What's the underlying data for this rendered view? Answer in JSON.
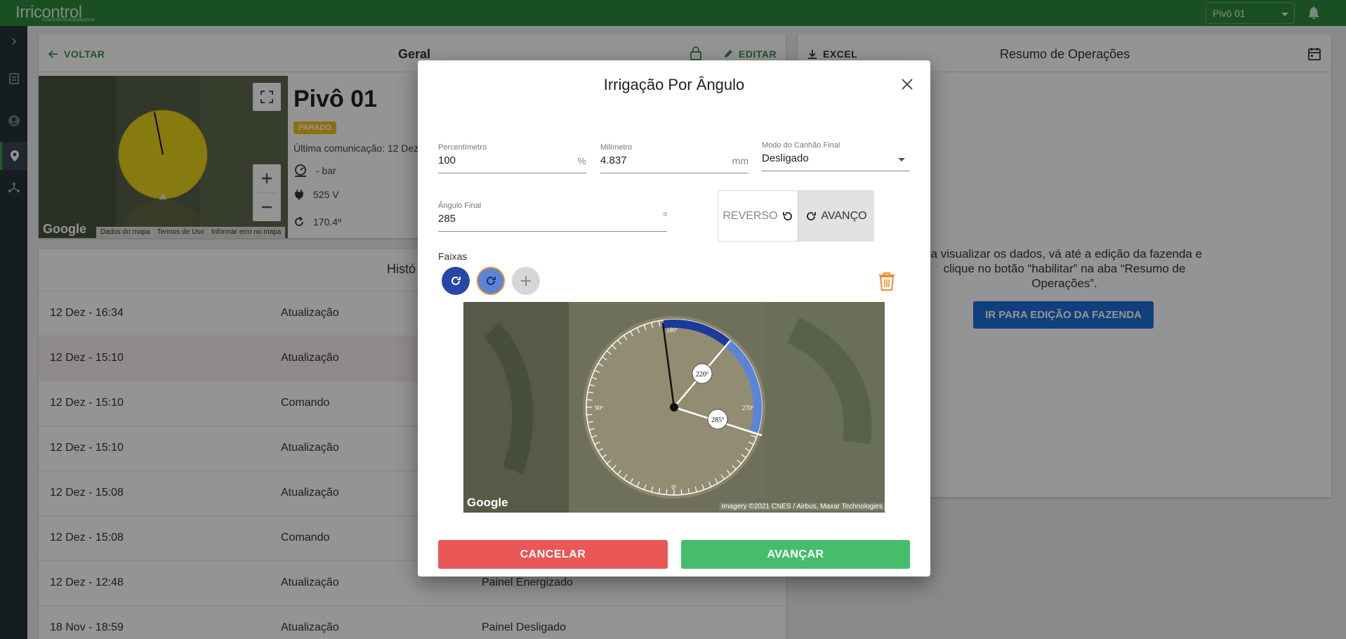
{
  "header": {
    "logo_text": "Irricontrol",
    "logo_tagline": "A ENERGIA DO AGRONEGÓCIO",
    "pivot_select_value": "Pivô 01"
  },
  "sidebar": {
    "items": [
      "expand",
      "reports",
      "user",
      "location",
      "network"
    ],
    "active": "location"
  },
  "general": {
    "back_label": "VOLTAR",
    "title": "Geral",
    "edit_label": "EDITAR",
    "pivot_name": "Pivô 01",
    "status": "PARADO",
    "last_comm": "Última comunicação: 12 Dez",
    "pressure": "- bar",
    "voltage": "525 V",
    "angle": "170.4º",
    "map_credit": "Google",
    "map_links": [
      "Dados do mapa",
      "Termos de Uso",
      "Informar erro no mapa"
    ]
  },
  "history": {
    "title": "Histó",
    "rows": [
      {
        "date": "12 Dez - 16:34",
        "type": "Atualização",
        "detail": ""
      },
      {
        "date": "12 Dez - 15:10",
        "type": "Atualização",
        "detail": ""
      },
      {
        "date": "12 Dez - 15:10",
        "type": "Comando",
        "detail": ""
      },
      {
        "date": "12 Dez - 15:10",
        "type": "Atualização",
        "detail": ""
      },
      {
        "date": "12 Dez - 15:08",
        "type": "Atualização",
        "detail": ""
      },
      {
        "date": "12 Dez - 15:08",
        "type": "Comando",
        "detail": ""
      },
      {
        "date": "12 Dez - 12:48",
        "type": "Atualização",
        "detail": "Painel Energizado"
      },
      {
        "date": "18 Nov - 18:59",
        "type": "Atualização",
        "detail": "Painel Desligado"
      }
    ]
  },
  "summary": {
    "excel_label": "EXCEL",
    "title": "Resumo de Operações",
    "message_line1": "ra visualizar os dados, vá até a edição da fazenda e",
    "message_line2": "clique no botão “habilitar” na aba “Resumo de",
    "message_line3": "Operações”.",
    "action_label": "IR PARA EDIÇÃO DA FAZENDA"
  },
  "modal": {
    "title": "Irrigação Por Ângulo",
    "percent_label": "Percentímetro",
    "percent_value": "100",
    "percent_unit": "%",
    "mm_label": "Milímetro",
    "mm_value": "4.837",
    "mm_unit": "mm",
    "gun_label": "Modo do Canhão Final",
    "gun_value": "Desligado",
    "angle_label": "Ângulo Final",
    "angle_value": "285",
    "angle_unit": "º",
    "reverse_label": "REVERSO",
    "forward_label": "AVANÇO",
    "direction_selected": "AVANÇO",
    "bands_label": "Faixas",
    "marker_220": "220º",
    "marker_285": "285º",
    "dial_labels": {
      "top": "180º",
      "left": "90º",
      "right": "270º",
      "bottom": "0º"
    },
    "map_credit": "Google",
    "imagery_credit": "Imagery ©2021 CNES / Airbus, Maxar Technologies",
    "cancel_label": "CANCELAR",
    "next_label": "AVANÇAR",
    "colors": {
      "cancel": "#e95757",
      "next": "#46bd6b",
      "band_dark": "#1a3a9e",
      "band_light": "#5b84d8",
      "delete": "#f08a28"
    }
  }
}
